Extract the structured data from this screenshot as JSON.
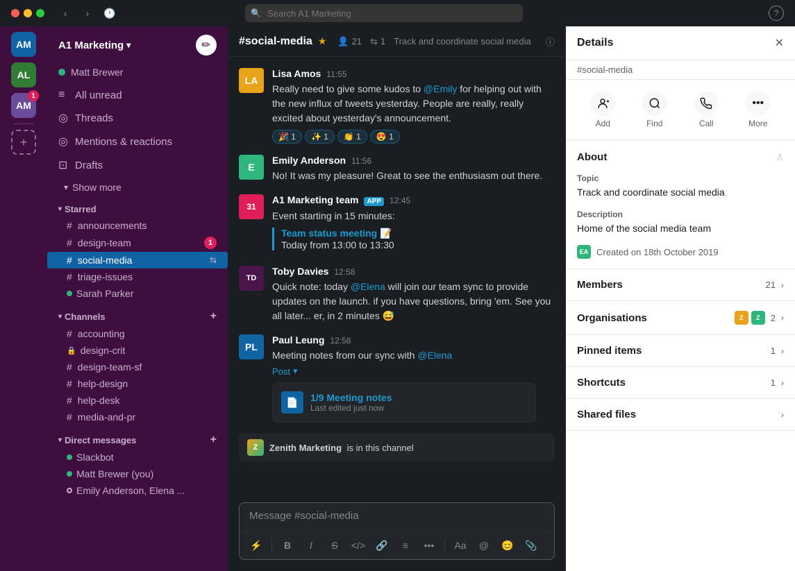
{
  "titlebar": {
    "search_placeholder": "Search A1 Marketing"
  },
  "workspace_bar": {
    "items": [
      {
        "label": "AM",
        "class": "am1",
        "badge": null
      },
      {
        "label": "AL",
        "class": "al",
        "badge": null
      },
      {
        "label": "AM",
        "class": "am2",
        "badge": "1"
      }
    ]
  },
  "sidebar": {
    "workspace_name": "A1 Marketing",
    "user_name": "Matt Brewer",
    "nav_items": [
      {
        "icon": "≡",
        "label": "All unread"
      },
      {
        "icon": "◎",
        "label": "Threads"
      },
      {
        "icon": "◎",
        "label": "Mentions & reactions"
      },
      {
        "icon": "⊡",
        "label": "Drafts"
      }
    ],
    "show_more": "Show more",
    "starred_section": "Starred",
    "starred_channels": [
      {
        "prefix": "#",
        "name": "announcements",
        "type": "public"
      },
      {
        "prefix": "#",
        "name": "design-team",
        "type": "public",
        "badge": "1"
      },
      {
        "prefix": "#",
        "name": "social-media",
        "type": "public",
        "active": true,
        "bookmark": true
      },
      {
        "prefix": "#",
        "name": "triage-issues",
        "type": "public"
      },
      {
        "name": "Sarah Parker",
        "type": "dm",
        "online": true
      }
    ],
    "channels_section": "Channels",
    "channels": [
      {
        "prefix": "#",
        "name": "accounting",
        "type": "public"
      },
      {
        "prefix": "🔒",
        "name": "design-crit",
        "type": "private"
      },
      {
        "prefix": "#",
        "name": "design-team-sf",
        "type": "public"
      },
      {
        "prefix": "#",
        "name": "help-design",
        "type": "public"
      },
      {
        "prefix": "#",
        "name": "help-desk",
        "type": "public"
      },
      {
        "prefix": "#",
        "name": "media-and-pr",
        "type": "public"
      }
    ],
    "dm_section": "Direct messages",
    "dms": [
      {
        "name": "Slackbot",
        "online": true
      },
      {
        "name": "Matt Brewer (you)",
        "online": true
      },
      {
        "name": "Emily Anderson, Elena ...",
        "online": false
      }
    ]
  },
  "chat": {
    "channel_name": "#social-media",
    "members_count": "21",
    "star_icon": "1",
    "description": "Track and coordinate social media",
    "messages": [
      {
        "id": "m1",
        "author": "Lisa Amos",
        "time": "11:55",
        "avatar_class": "lisa",
        "avatar_label": "LA",
        "text_parts": [
          {
            "type": "text",
            "content": "Really need to give some kudos to "
          },
          {
            "type": "mention",
            "content": "@Emily"
          },
          {
            "type": "text",
            "content": " for helping out with the new influx of tweets yesterday. People are really, really excited about yesterday's announcement."
          }
        ],
        "reactions": [
          {
            "emoji": "🎉",
            "count": "1"
          },
          {
            "emoji": "✨",
            "count": "1"
          },
          {
            "emoji": "👏",
            "count": "1"
          },
          {
            "emoji": "😍",
            "count": "1"
          }
        ]
      },
      {
        "id": "m2",
        "author": "Emily Anderson",
        "time": "11:56",
        "avatar_class": "emily",
        "avatar_label": "E",
        "text": "No! It was my pleasure! Great to see the enthusiasm out there.",
        "reactions": []
      },
      {
        "id": "m3",
        "author": "A1 Marketing team",
        "time": "12:45",
        "avatar_class": "a1",
        "avatar_label": "31",
        "app_badge": "APP",
        "text": "Event starting in 15 minutes:",
        "quoted_title": "Team status meeting 📝",
        "quoted_text": "Today from 13:00 to 13:30",
        "reactions": []
      },
      {
        "id": "m4",
        "author": "Toby Davies",
        "time": "12:58",
        "avatar_class": "toby",
        "avatar_label": "TD",
        "text_parts": [
          {
            "type": "text",
            "content": "Quick note: today "
          },
          {
            "type": "mention",
            "content": "@Elena"
          },
          {
            "type": "text",
            "content": " will join our team sync to provide updates on the launch. if you have questions, bring 'em. See you all later... er, in 2 minutes 😅"
          }
        ],
        "reactions": []
      },
      {
        "id": "m5",
        "author": "Paul Leung",
        "time": "12:58",
        "avatar_class": "paul",
        "avatar_label": "PL",
        "text_parts": [
          {
            "type": "text",
            "content": "Meeting notes from our sync with "
          },
          {
            "type": "mention",
            "content": "@Elena"
          }
        ],
        "post_label": "Post",
        "attachment": {
          "title": "1/9 Meeting notes",
          "meta": "Last edited just now"
        },
        "reactions": []
      }
    ],
    "join_banner": {
      "badge_label": "Z",
      "text": "Zenith Marketing",
      "text2": "is in this channel"
    },
    "input_placeholder": "Message #social-media"
  },
  "details": {
    "title": "Details",
    "subtitle": "#social-media",
    "actions": [
      {
        "icon": "👤+",
        "label": "Add"
      },
      {
        "icon": "🔍",
        "label": "Find"
      },
      {
        "icon": "📞",
        "label": "Call"
      },
      {
        "icon": "•••",
        "label": "More"
      }
    ],
    "about_section": "About",
    "topic_label": "Topic",
    "topic_value": "Track and coordinate social media",
    "description_label": "Description",
    "description_value": "Home of the social media team",
    "created_text": "Created on 18th October 2019",
    "members_label": "Members",
    "members_count": "21",
    "orgs_label": "Organisations",
    "orgs_count": "2",
    "pinned_label": "Pinned items",
    "pinned_count": "1",
    "shortcuts_label": "Shortcuts",
    "shortcuts_count": "1",
    "shared_label": "Shared files"
  }
}
